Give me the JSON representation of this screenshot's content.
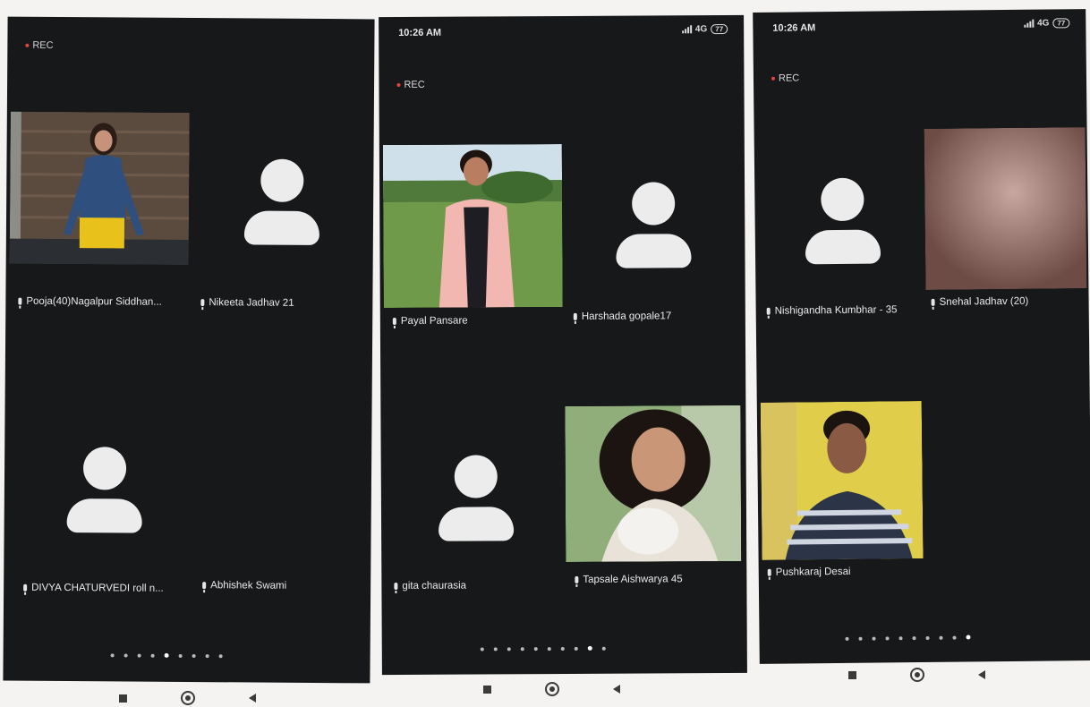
{
  "screens": [
    {
      "status": null,
      "rec_label": "REC",
      "participants": [
        {
          "name": "Pooja(40)Nagalpur Siddhan...",
          "video": true,
          "avatar": "seated-woman-video"
        },
        {
          "name": "Nikeeta Jadhav 21",
          "video": false,
          "avatar": "person-placeholder-icon"
        },
        {
          "name": "DIVYA CHATURVEDI roll n...",
          "video": false,
          "avatar": "person-placeholder-icon"
        },
        {
          "name": "Abhishek Swami",
          "video": false,
          "avatar": "none"
        }
      ],
      "page_dots": 9,
      "active_dot": 4
    },
    {
      "status": {
        "time": "10:26 AM",
        "network": "4G",
        "battery": "77"
      },
      "rec_label": "REC",
      "participants": [
        {
          "name": "Payal Pansare",
          "video": true,
          "avatar": "woman-outdoor-video"
        },
        {
          "name": "Harshada gopale17",
          "video": false,
          "avatar": "person-placeholder-icon"
        },
        {
          "name": "gita chaurasia",
          "video": false,
          "avatar": "person-placeholder-icon"
        },
        {
          "name": "Tapsale Aishwarya 45",
          "video": true,
          "avatar": "woman-with-puppy-video"
        }
      ],
      "page_dots": 10,
      "active_dot": 8
    },
    {
      "status": {
        "time": "10:26 AM",
        "network": "4G",
        "battery": "77"
      },
      "rec_label": "REC",
      "participants": [
        {
          "name": "Nishigandha Kumbhar - 35",
          "video": false,
          "avatar": "person-placeholder-icon"
        },
        {
          "name": "Snehal Jadhav (20)",
          "video": true,
          "avatar": "blank-pink-video"
        },
        {
          "name": "Pushkaraj Desai",
          "video": true,
          "avatar": "man-yellow-wall-video"
        }
      ],
      "page_dots": 10,
      "active_dot": 9
    }
  ],
  "nav_icons": [
    "recents-square-icon",
    "home-circle-icon",
    "back-triangle-icon"
  ]
}
